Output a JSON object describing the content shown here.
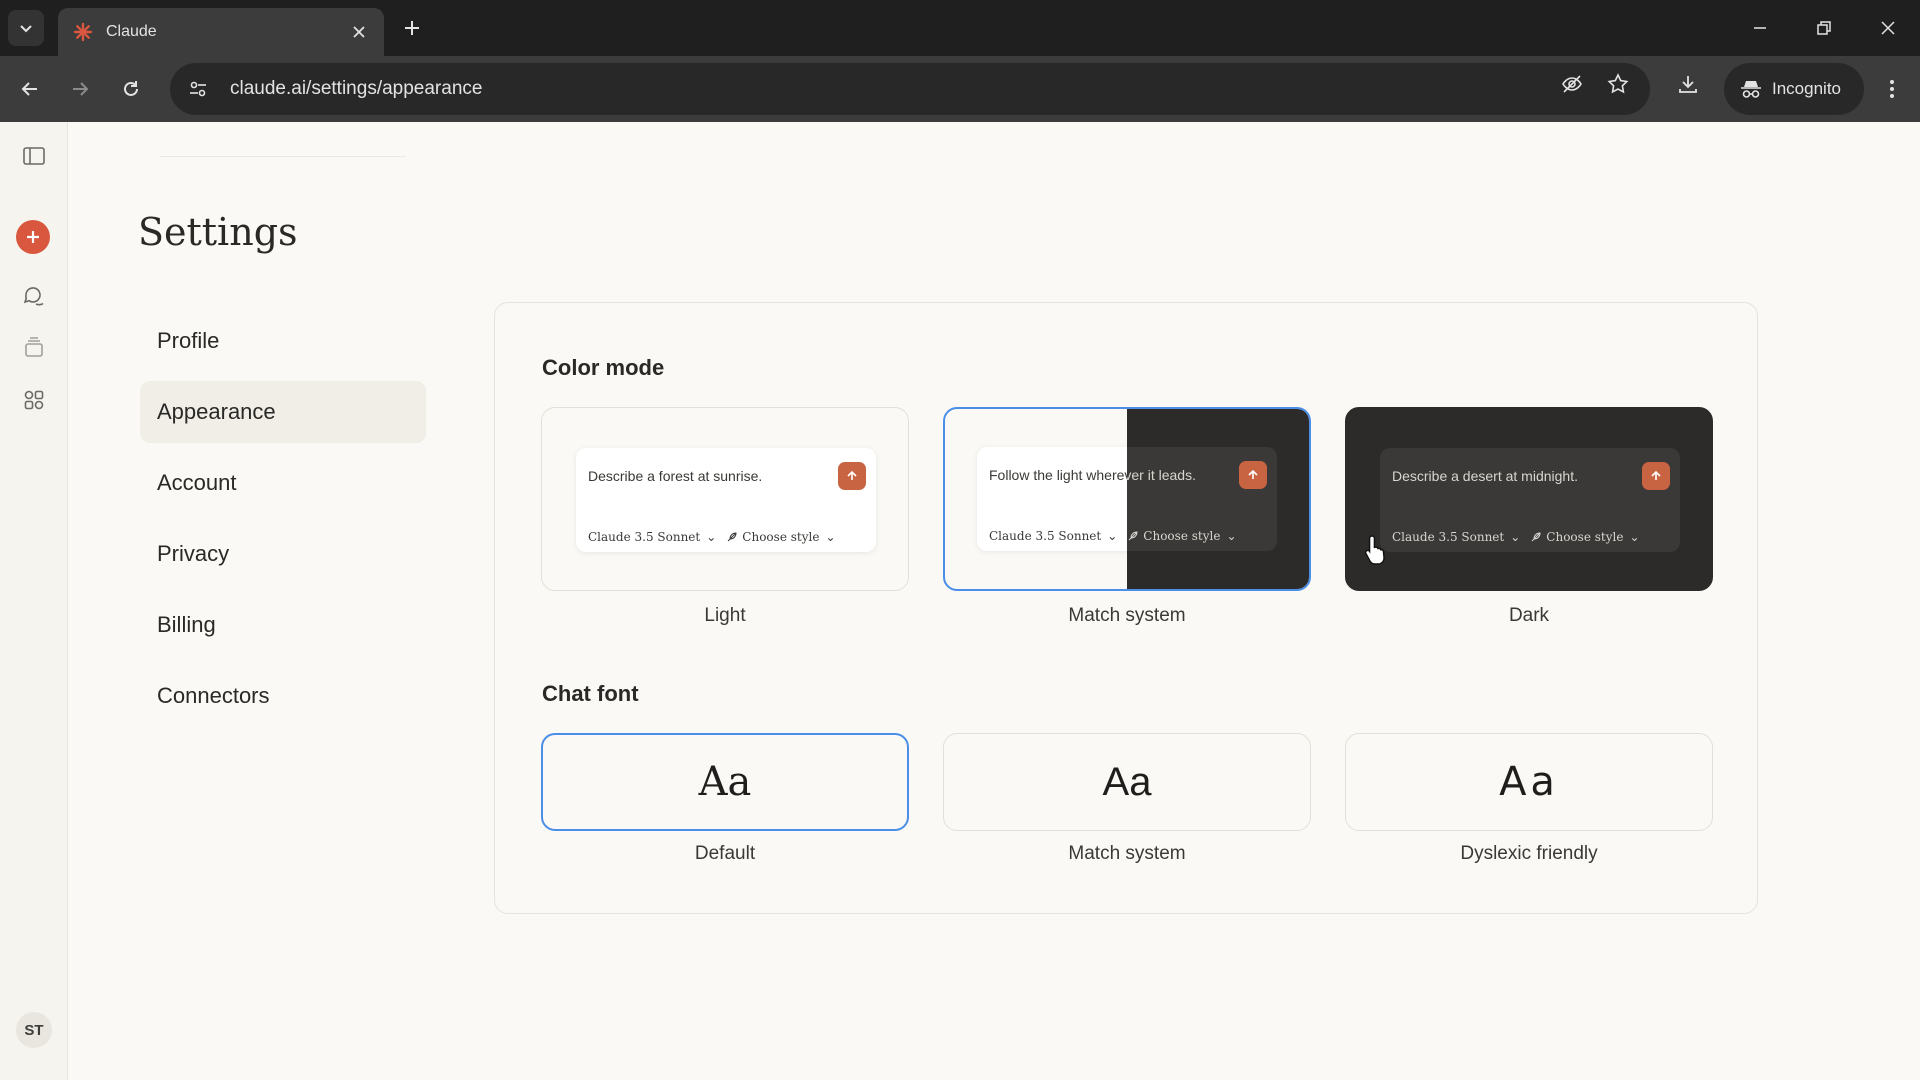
{
  "browser": {
    "tab_title": "Claude",
    "url": "claude.ai/settings/appearance",
    "profile_label": "Incognito"
  },
  "rail": {
    "avatar_initials": "ST"
  },
  "settings": {
    "title": "Settings",
    "nav": [
      {
        "label": "Profile",
        "active": false
      },
      {
        "label": "Appearance",
        "active": true
      },
      {
        "label": "Account",
        "active": false
      },
      {
        "label": "Privacy",
        "active": false
      },
      {
        "label": "Billing",
        "active": false
      },
      {
        "label": "Connectors",
        "active": false
      }
    ]
  },
  "color_mode": {
    "title": "Color mode",
    "selected": "Match system",
    "model_label": "Claude 3.5 Sonnet",
    "style_label": "Choose style",
    "options": [
      {
        "label": "Light",
        "prompt": "Describe a forest at sunrise."
      },
      {
        "label": "Match system",
        "prompt": "Follow the light wherever it leads."
      },
      {
        "label": "Dark",
        "prompt": "Describe a desert at midnight."
      }
    ]
  },
  "chat_font": {
    "title": "Chat font",
    "selected": "Default",
    "sample": "Aa",
    "options": [
      {
        "label": "Default"
      },
      {
        "label": "Match system"
      },
      {
        "label": "Dyslexic friendly"
      }
    ]
  },
  "colors": {
    "accent_orange": "#d9573e",
    "send_button": "#c96442",
    "selection_blue": "#4b8ee8",
    "page_bg": "#faf9f5"
  }
}
